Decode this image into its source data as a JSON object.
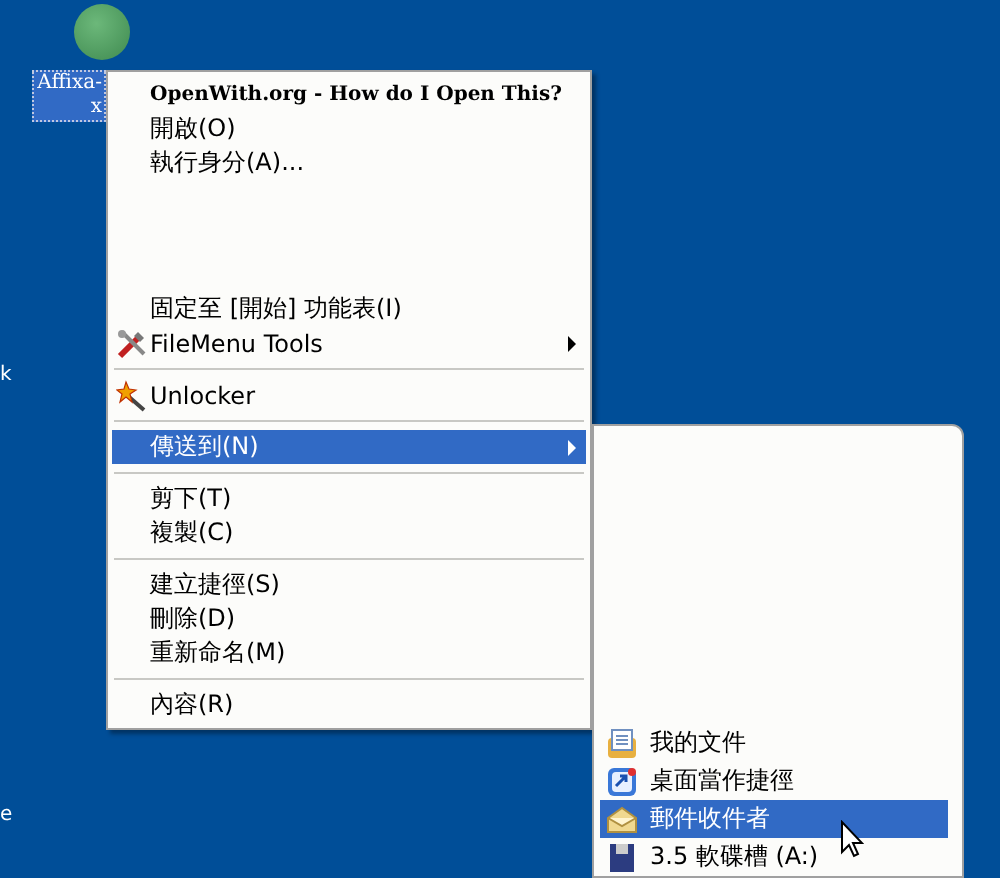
{
  "desktop": {
    "icon": {
      "label_lines": [
        "Affixa-",
        "x"
      ],
      "selected": true
    },
    "edge_labels": [
      "k",
      "e"
    ]
  },
  "context_menu": {
    "items": [
      {
        "kind": "header",
        "label": "OpenWith.org - How do I Open This?",
        "selected": false
      },
      {
        "kind": "item",
        "label": "開啟(O)",
        "selected": false
      },
      {
        "kind": "item",
        "label": "執行身分(A)...",
        "selected": false
      },
      {
        "kind": "blank"
      },
      {
        "kind": "item",
        "label": "固定至 [開始] 功能表(I)",
        "selected": false
      },
      {
        "kind": "item",
        "label": "FileMenu Tools",
        "submenu": true,
        "selected": false
      },
      {
        "kind": "separator"
      },
      {
        "kind": "item",
        "label": "Unlocker",
        "selected": false
      },
      {
        "kind": "separator"
      },
      {
        "kind": "item",
        "label": "傳送到(N)",
        "submenu": true,
        "selected": true
      },
      {
        "kind": "separator"
      },
      {
        "kind": "item",
        "label": "剪下(T)",
        "selected": false
      },
      {
        "kind": "item",
        "label": "複製(C)",
        "selected": false
      },
      {
        "kind": "separator"
      },
      {
        "kind": "item",
        "label": "建立捷徑(S)",
        "selected": false
      },
      {
        "kind": "item",
        "label": "刪除(D)",
        "selected": false
      },
      {
        "kind": "item",
        "label": "重新命名(M)",
        "selected": false
      },
      {
        "kind": "separator"
      },
      {
        "kind": "item",
        "label": "內容(R)",
        "selected": false
      }
    ]
  },
  "send_to_menu": {
    "items": [
      {
        "label": "我的文件",
        "selected": false
      },
      {
        "label": "桌面當作捷徑",
        "selected": false
      },
      {
        "label": "郵件收件者",
        "selected": true
      },
      {
        "label": "3.5 軟碟槽 (A:)",
        "selected": false
      }
    ]
  }
}
